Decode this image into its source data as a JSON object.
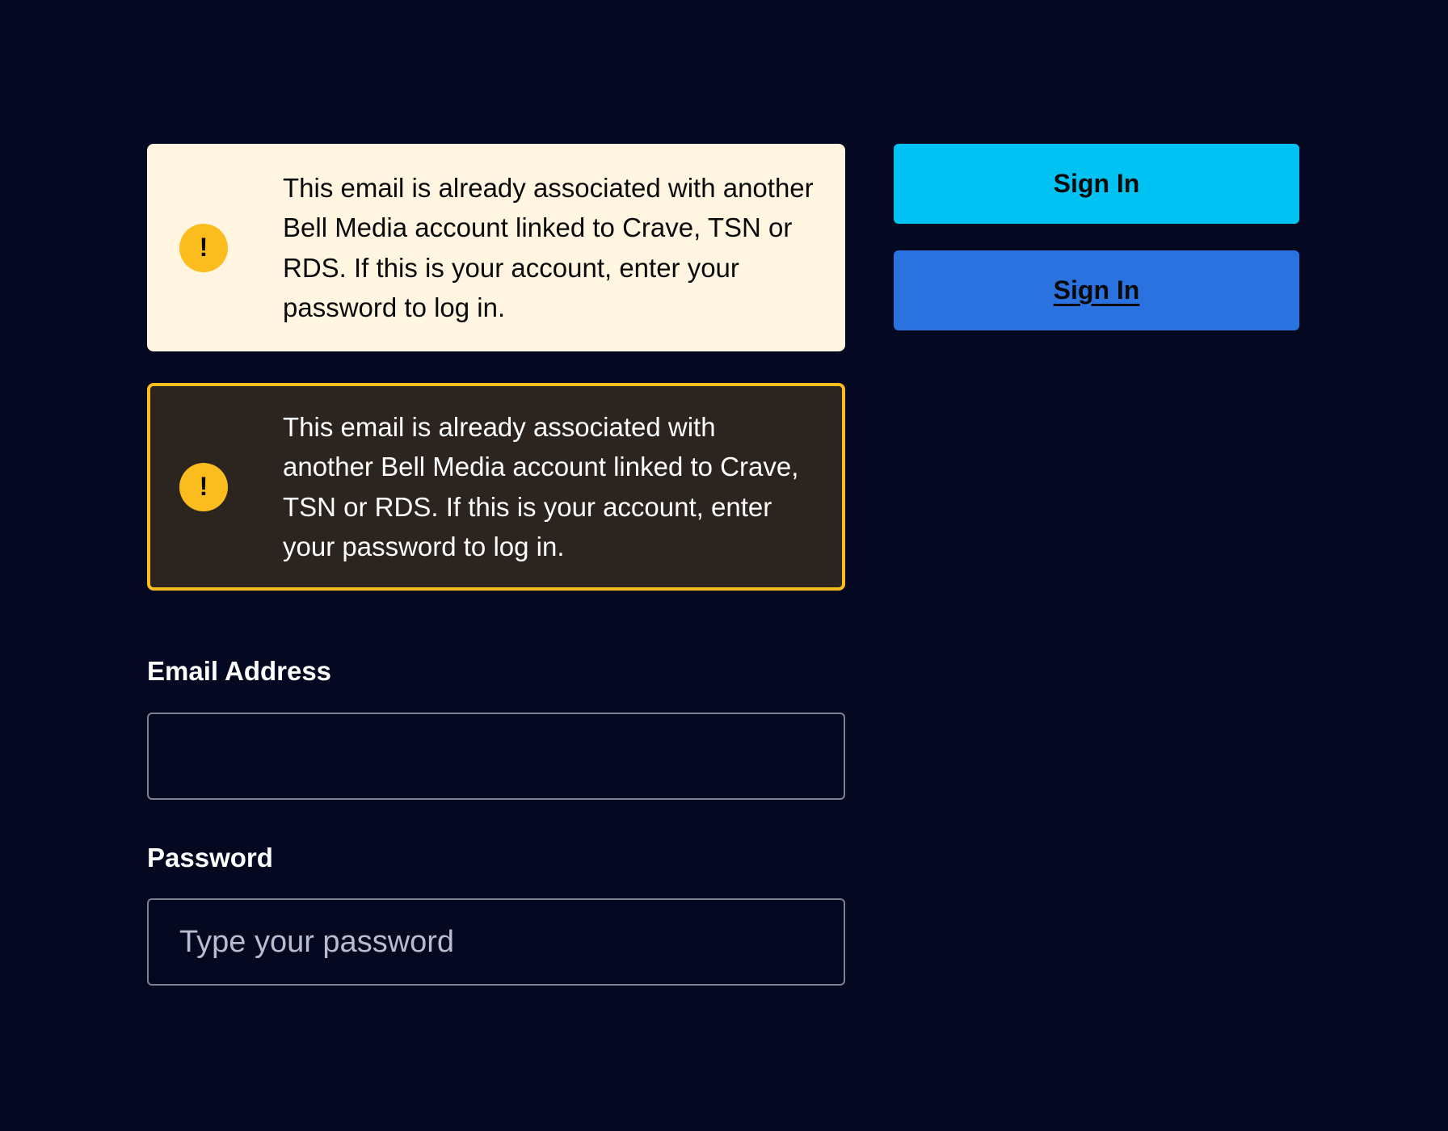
{
  "alerts": {
    "light": {
      "icon": "exclamation-icon",
      "icon_glyph": "!",
      "message": "This email is already associated with another Bell Media account linked to Crave, TSN or RDS. If this is your account, enter your password to log in."
    },
    "dark": {
      "icon": "exclamation-icon",
      "icon_glyph": "!",
      "message": "This email is already associated with another Bell Media account linked to Crave, TSN or RDS. If this is your account, enter your password to log in."
    }
  },
  "buttons": {
    "primary_label": "Sign In",
    "hover_label": "Sign In"
  },
  "form": {
    "email": {
      "label": "Email Address",
      "value": "",
      "placeholder": ""
    },
    "password": {
      "label": "Password",
      "value": "",
      "placeholder": "Type your password"
    }
  },
  "colors": {
    "background": "#040820",
    "alert_light_bg": "#fff5e0",
    "alert_dark_bg": "#2b241f",
    "warning_yellow": "#fbbc1e",
    "button_primary": "#00c3f4",
    "button_hover": "#2a72e0",
    "input_border": "#7c8090"
  }
}
